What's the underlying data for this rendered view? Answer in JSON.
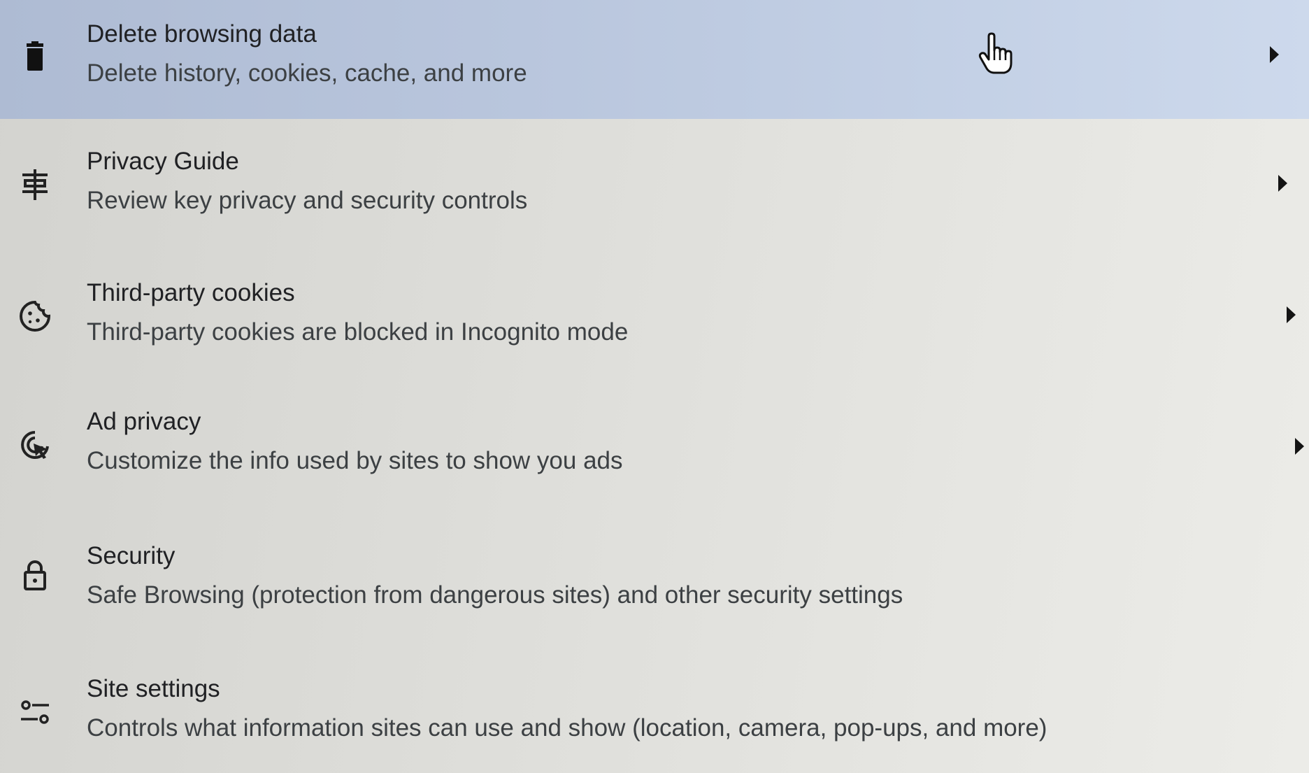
{
  "settings_list": {
    "items": [
      {
        "title": "Delete browsing data",
        "subtitle": "Delete history, cookies, cache, and more",
        "icon": "trash-icon",
        "highlighted": true
      },
      {
        "title": "Privacy Guide",
        "subtitle": "Review key privacy and security controls",
        "icon": "privacy-guide-icon",
        "highlighted": false
      },
      {
        "title": "Third-party cookies",
        "subtitle": "Third-party cookies are blocked in Incognito mode",
        "icon": "cookie-icon",
        "highlighted": false
      },
      {
        "title": "Ad privacy",
        "subtitle": "Customize the info used by sites to show you ads",
        "icon": "ad-privacy-icon",
        "highlighted": false
      },
      {
        "title": "Security",
        "subtitle": "Safe Browsing (protection from dangerous sites) and other security settings",
        "icon": "lock-icon",
        "highlighted": false
      },
      {
        "title": "Site settings",
        "subtitle": "Controls what information sites can use and show (location, camera, pop-ups, and more)",
        "icon": "tune-icon",
        "highlighted": false
      }
    ]
  },
  "colors": {
    "highlight": "#c4d1e6",
    "text_primary": "#202124",
    "text_secondary": "#3c4043"
  },
  "cursor": "hand-pointer-icon"
}
